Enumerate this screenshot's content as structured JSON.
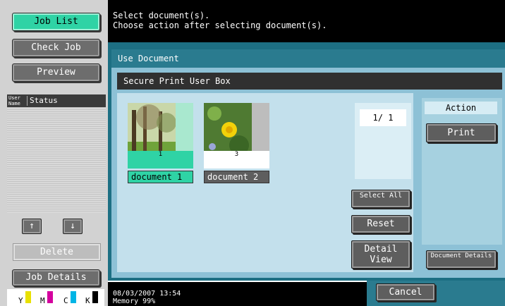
{
  "left_panel": {
    "job_list": "Job List",
    "check_job": "Check Job",
    "preview": "Preview",
    "col_user_name": "User Name",
    "col_status": "Status",
    "up_arrow": "↑",
    "down_arrow": "↓",
    "delete": "Delete",
    "job_details": "Job Details",
    "toner": [
      "Y",
      "M",
      "C",
      "K"
    ]
  },
  "message": {
    "line1": "Select document(s).",
    "line2": "Choose action after selecting document(s)."
  },
  "screen": {
    "title": "Use Document",
    "box_name": "Secure Print User Box"
  },
  "documents": [
    {
      "name": "document 1",
      "pages": "1",
      "selected": true
    },
    {
      "name": "document 2",
      "pages": "3",
      "selected": false
    }
  ],
  "page_indicator": "1/  1",
  "buttons": {
    "select_all": "Select All",
    "reset": "Reset",
    "detail_view": "Detail View",
    "action_label": "Action",
    "print": "Print",
    "document_details": "Document Details",
    "cancel": "Cancel"
  },
  "status": {
    "datetime": "08/03/2007    13:54",
    "memory": "Memory      99%"
  },
  "colors": {
    "active_green": "#2fd3a5",
    "teal": "#1d6f83",
    "toner_y": "#e8e000",
    "toner_m": "#d4009e",
    "toner_c": "#00b5e6",
    "toner_k": "#000000"
  }
}
